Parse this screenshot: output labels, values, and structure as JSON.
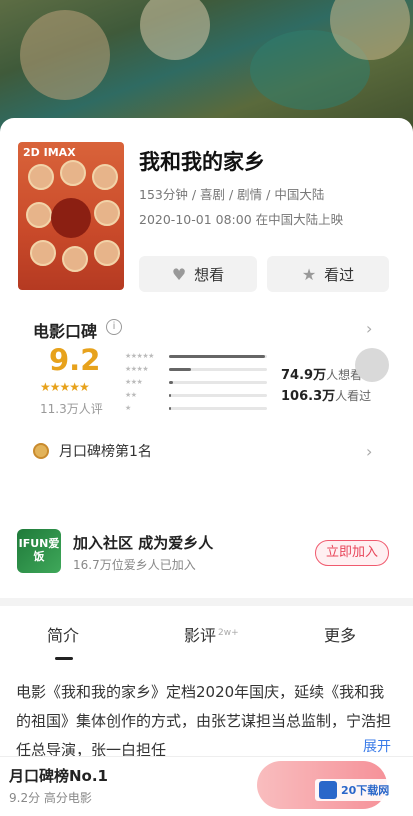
{
  "movie": {
    "poster_tag": "2D IMAX",
    "title": "我和我的家乡",
    "meta_line": "153分钟 / 喜剧 / 剧情 / 中国大陆",
    "release_line": "2020-10-01 08:00 在中国大陆上映"
  },
  "actions": {
    "want_label": "想看",
    "seen_label": "看过"
  },
  "rating": {
    "section_title": "电影口碑",
    "score": "9.2",
    "stars": "★★★★★",
    "count": "11.3万人评",
    "distribution": [
      {
        "stars": "★★★★★",
        "fraction": 0.98
      },
      {
        "stars": "★★★★",
        "fraction": 0.22
      },
      {
        "stars": "★★★",
        "fraction": 0.04
      },
      {
        "stars": "★★",
        "fraction": 0.02
      },
      {
        "stars": "★",
        "fraction": 0.02
      }
    ],
    "want_count": "74.9万",
    "want_suffix": "人想看",
    "seen_count": "106.3万",
    "seen_suffix": "人看过",
    "rank_text": "月口碑榜第1名"
  },
  "community": {
    "logo_text": "IFUN爱饭",
    "title": "加入社区 成为爱乡人",
    "subtitle": "16.7万位爱乡人已加入",
    "join_label": "立即加入"
  },
  "tabs": [
    {
      "label": "简介"
    },
    {
      "label": "影评",
      "badge": "2w+"
    },
    {
      "label": "更多"
    }
  ],
  "description": {
    "text": "电影《我和我的家乡》定档2020年国庆，延续《我和我的祖国》集体创作的方式，由张艺谋担当总监制，宁浩担任总导演，张一白担任",
    "expand_label": "展开"
  },
  "bottom_bar": {
    "title": "月口碑榜No.1",
    "subtitle": "9.2分  高分电影"
  },
  "watermark": {
    "text": "20下载网"
  }
}
